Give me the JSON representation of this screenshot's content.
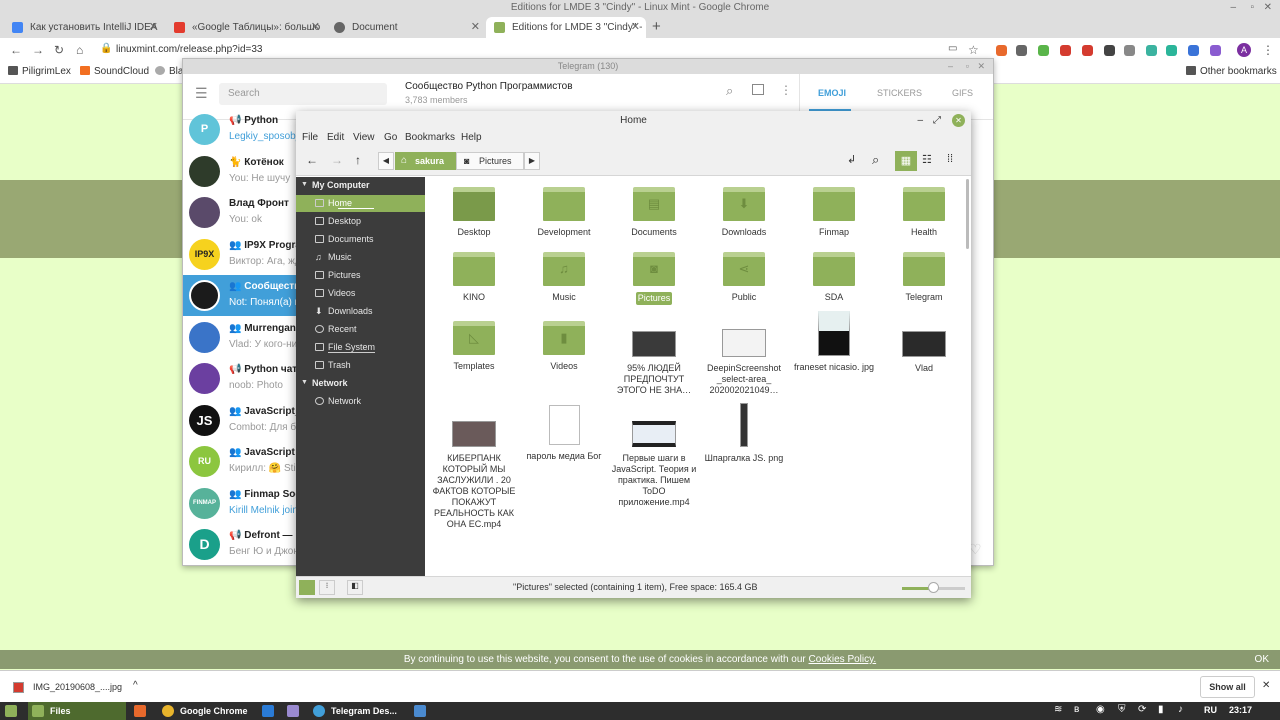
{
  "chrome": {
    "window_title": "Editions for LMDE 3 \"Cindy\" - Linux Mint - Google Chrome",
    "tabs": [
      {
        "label": "Как установить IntelliJ IDEA",
        "color": "#4285f4"
      },
      {
        "label": "«Google Таблицы»: большо",
        "color": "#e33b2e"
      },
      {
        "label": "Document",
        "color": "#666666"
      },
      {
        "label": "Editions for LMDE 3 \"Cindy\" - L",
        "color": "#8fb15a"
      }
    ],
    "new_tab": "+",
    "url": "linuxmint.com/release.php?id=33",
    "bookmarks": [
      "PiligrimLex",
      "SoundCloud",
      "Bla"
    ],
    "other_bookmarks": "Other bookmarks",
    "profile_initial": "A"
  },
  "telegram": {
    "title": "Telegram (130)",
    "search_placeholder": "Search",
    "chat_title": "Сообщество Python Программистов",
    "members": "3,783 members",
    "panel_tabs": [
      "EMOJI",
      "STICKERS",
      "GIFS"
    ],
    "chats": [
      {
        "name": "📢 Python",
        "msg": "Legkiy_sposob_v",
        "avatar": "P",
        "color": "#60c4d9"
      },
      {
        "name": "🐈 Котёнок",
        "msg": "You: Не шучу",
        "avatar": "",
        "color": "#2e3b2a"
      },
      {
        "name": "Влад Фронт",
        "msg": "You: ok",
        "avatar": "",
        "color": "#5a4a6a"
      },
      {
        "name": "👥 IP9X Program",
        "msg": "Виктор: Ага, жди",
        "avatar": "IP9X",
        "color": "#f6d21e"
      },
      {
        "name": "👥 Сообщество",
        "msg": "Not: Понял(а) по",
        "avatar": "",
        "color": "#1b1b1b"
      },
      {
        "name": "👥 Murrengan",
        "msg": "Vlad: У кого-ниб",
        "avatar": "",
        "color": "#3a74c8"
      },
      {
        "name": "📢 Python чат",
        "msg": "noob: Photo",
        "avatar": "",
        "color": "#6b3fa0"
      },
      {
        "name": "👥 JavaScript_2.0",
        "msg": "Combot: Для бы",
        "avatar": "JS",
        "color": "#111111"
      },
      {
        "name": "👥 JavaScript Ru",
        "msg": "Кирилл: 🤗 Stick",
        "avatar": "RU",
        "color": "#8cc63f"
      },
      {
        "name": "👥 Finmap Soob",
        "msg": "Kirill Melnik joine",
        "avatar": "FINMAP",
        "color": "#57b29a"
      },
      {
        "name": "📢 Defront — пр",
        "msg": "Бенг Ю и Джона",
        "avatar": "D",
        "color": "#1aa08a"
      }
    ]
  },
  "nemo": {
    "title": "Home",
    "menus": [
      "File",
      "Edit",
      "View",
      "Go",
      "Bookmarks",
      "Help"
    ],
    "path": [
      "sakura",
      "Pictures"
    ],
    "sidebar": {
      "section_computer": "My Computer",
      "items": [
        "Home",
        "Desktop",
        "Documents",
        "Music",
        "Pictures",
        "Videos",
        "Downloads",
        "Recent",
        "File System",
        "Trash"
      ],
      "section_network": "Network",
      "network_items": [
        "Network"
      ]
    },
    "files": [
      {
        "name": "Desktop",
        "kind": "folder",
        "sym": ""
      },
      {
        "name": "Development",
        "kind": "folder",
        "sym": ""
      },
      {
        "name": "Documents",
        "kind": "folder",
        "sym": "▤"
      },
      {
        "name": "Downloads",
        "kind": "folder",
        "sym": "⬇"
      },
      {
        "name": "Finmap",
        "kind": "folder",
        "sym": ""
      },
      {
        "name": "Health",
        "kind": "folder",
        "sym": ""
      },
      {
        "name": "KINO",
        "kind": "folder",
        "sym": ""
      },
      {
        "name": "Music",
        "kind": "folder",
        "sym": "♫"
      },
      {
        "name": "Pictures",
        "kind": "folder",
        "sym": "◙",
        "selected": true
      },
      {
        "name": "Public",
        "kind": "folder",
        "sym": "⋖"
      },
      {
        "name": "SDA",
        "kind": "folder",
        "sym": ""
      },
      {
        "name": "Telegram",
        "kind": "folder",
        "sym": ""
      },
      {
        "name": "Templates",
        "kind": "folder",
        "sym": "◺"
      },
      {
        "name": "Videos",
        "kind": "folder",
        "sym": "▮"
      },
      {
        "name": "95% ЛЮДЕЙ ПРЕДПОЧТУТ ЭТОГО НЕ ЗНА…",
        "kind": "video"
      },
      {
        "name": "DeepinScreenshot _select-area_ 202002021049…",
        "kind": "image-light"
      },
      {
        "name": "franeset nicasio. jpg",
        "kind": "image"
      },
      {
        "name": "Vlad",
        "kind": "video"
      },
      {
        "name": "КИБЕРПАНК КОТОРЫЙ МЫ ЗАСЛУЖИЛИ . 20 ФАКТОВ КОТОРЫЕ ПОКАЖУТ РЕАЛЬНОСТЬ КАК ОНА ЕС.mp4",
        "kind": "video"
      },
      {
        "name": "пароль медиа Бог",
        "kind": "text"
      },
      {
        "name": "Первые шаги в JavaScript. Теория и практика. Пишем ToDO приложение.mp4",
        "kind": "video"
      },
      {
        "name": "Шпаргалка JS. png",
        "kind": "image-tall"
      }
    ],
    "status": "\"Pictures\" selected (containing 1 item), Free space: 165.4 GB"
  },
  "cookie": {
    "text": "By continuing to use this website, you consent to the use of cookies in accordance with our",
    "link": "Cookies Policy.",
    "ok": "OK"
  },
  "downloads": {
    "file": "IMG_20190608_....jpg",
    "show_all": "Show all"
  },
  "taskbar": {
    "tasks": [
      "Files",
      "Google Chrome",
      "Telegram Des..."
    ],
    "lang": "RU",
    "time": "23:17"
  },
  "colors": {
    "mint_green": "#8fb15a",
    "telegram_blue": "#419fd9",
    "sidebar_dark": "#3c3c3c"
  }
}
